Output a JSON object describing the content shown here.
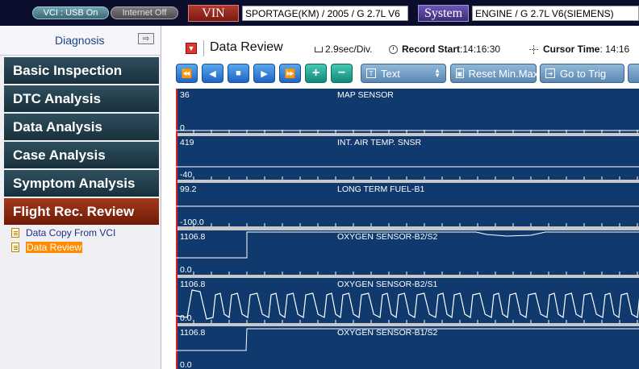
{
  "topbar": {
    "vci_status": "VCI : USB On",
    "internet_status": "Internet Off",
    "vin_tag": "VIN",
    "vin_value": "SPORTAGE(KM) / 2005 / G 2.7L V6",
    "system_tag": "System",
    "system_value": "ENGINE / G 2.7L V6(SIEMENS)"
  },
  "sidebar": {
    "title": "Diagnosis",
    "toggle_icon": "collapse-sidebar-icon",
    "menu": [
      {
        "label": "Basic Inspection"
      },
      {
        "label": "DTC Analysis"
      },
      {
        "label": "Data Analysis"
      },
      {
        "label": "Case Analysis"
      },
      {
        "label": "Symptom Analysis"
      },
      {
        "label": "Flight Rec. Review"
      }
    ],
    "submenu": [
      {
        "label": "Data Copy From VCI"
      },
      {
        "label": "Data Review"
      }
    ]
  },
  "header": {
    "title": "Data Review",
    "scale": "2.9sec/Div.",
    "record_start_label": "Record Start",
    "record_start_value": ":14:16:30",
    "cursor_time_label": "Cursor Time",
    "cursor_time_value": ": 14:16"
  },
  "toolbar": {
    "buttons": [
      "⏪",
      "◀",
      "■",
      "▶",
      "⏩",
      "+",
      "−"
    ],
    "text_label": "Text",
    "reset_label": "Reset Min.Max.",
    "go_trig_label": "Go to Trig"
  },
  "lanes": [
    {
      "name": "MAP SENSOR",
      "max": "36",
      "min": "0"
    },
    {
      "name": "INT. AIR TEMP. SNSR",
      "max": "419",
      "min": "-40"
    },
    {
      "name": "LONG TERM FUEL-B1",
      "max": "99.2",
      "min": "-100.0"
    },
    {
      "name": "OXYGEN SENSOR-B2/S2",
      "max": "1106.8",
      "min": "0.0"
    },
    {
      "name": "OXYGEN SENSOR-B2/S1",
      "max": "1106.8",
      "min": "0.0"
    },
    {
      "name": "OXYGEN SENSOR-B1/S2",
      "max": "1106.8",
      "min": "0.0"
    }
  ],
  "colors": {
    "graph_bg": "#103a6e",
    "menu_bg": "#24404d",
    "menu_active": "#8a2a10",
    "selected_item": "#ff8c00"
  }
}
